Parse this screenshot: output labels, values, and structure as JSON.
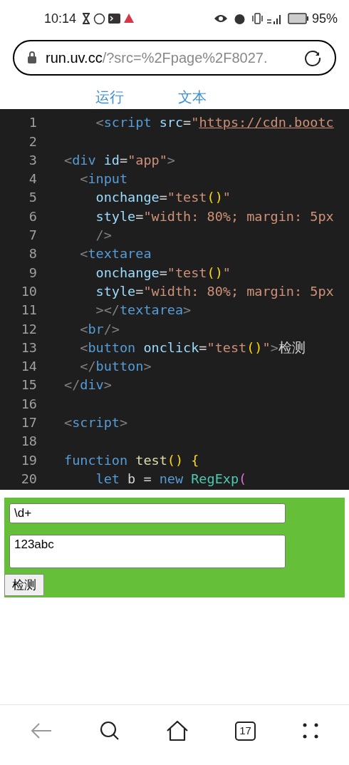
{
  "status_bar": {
    "time": "10:14",
    "battery": "95%"
  },
  "address_bar": {
    "host": "run.uv.cc",
    "path": "/?src=%2Fpage%2F8027."
  },
  "tabs": [
    {
      "label": "运行"
    },
    {
      "label": "文本"
    }
  ],
  "editor": {
    "lines": [
      {
        "number": "1",
        "tokens": [
          {
            "kind": "punct",
            "text": "    <"
          },
          {
            "kind": "tag",
            "text": "script"
          },
          {
            "kind": "attr",
            "text": " src"
          },
          {
            "kind": "plain",
            "text": "="
          },
          {
            "kind": "str",
            "text": "\""
          },
          {
            "kind": "url",
            "text": "https://cdn.bootc"
          }
        ]
      },
      {
        "number": "2"
      },
      {
        "number": "3",
        "tokens": [
          {
            "kind": "punct",
            "text": "<"
          },
          {
            "kind": "tag",
            "text": "div"
          },
          {
            "kind": "attr",
            "text": " id"
          },
          {
            "kind": "plain",
            "text": "="
          },
          {
            "kind": "str",
            "text": "\"app\""
          },
          {
            "kind": "punct",
            "text": ">"
          }
        ]
      },
      {
        "number": "4",
        "tokens": [
          {
            "kind": "punct",
            "text": "  <"
          },
          {
            "kind": "tag",
            "text": "input"
          }
        ]
      },
      {
        "number": "5",
        "tokens": [
          {
            "kind": "attr",
            "text": "    onchange"
          },
          {
            "kind": "plain",
            "text": "="
          },
          {
            "kind": "str",
            "text": "\"test"
          },
          {
            "kind": "paren",
            "text": "()"
          },
          {
            "kind": "str",
            "text": "\""
          }
        ]
      },
      {
        "number": "6",
        "tokens": [
          {
            "kind": "attr",
            "text": "    style"
          },
          {
            "kind": "plain",
            "text": "="
          },
          {
            "kind": "str",
            "text": "\"width: 80%; margin: 5px"
          }
        ]
      },
      {
        "number": "7",
        "tokens": [
          {
            "kind": "punct",
            "text": "    />"
          }
        ]
      },
      {
        "number": "8",
        "tokens": [
          {
            "kind": "punct",
            "text": "  <"
          },
          {
            "kind": "tag",
            "text": "textarea"
          }
        ]
      },
      {
        "number": "9",
        "tokens": [
          {
            "kind": "attr",
            "text": "    onchange"
          },
          {
            "kind": "plain",
            "text": "="
          },
          {
            "kind": "str",
            "text": "\"test"
          },
          {
            "kind": "paren",
            "text": "()"
          },
          {
            "kind": "str",
            "text": "\""
          }
        ]
      },
      {
        "number": "10",
        "tokens": [
          {
            "kind": "attr",
            "text": "    style"
          },
          {
            "kind": "plain",
            "text": "="
          },
          {
            "kind": "str",
            "text": "\"width: 80%; margin: 5px"
          }
        ]
      },
      {
        "number": "11",
        "tokens": [
          {
            "kind": "punct",
            "text": "    ></"
          },
          {
            "kind": "tag",
            "text": "textarea"
          },
          {
            "kind": "punct",
            "text": ">"
          }
        ]
      },
      {
        "number": "12",
        "tokens": [
          {
            "kind": "punct",
            "text": "  <"
          },
          {
            "kind": "tag",
            "text": "br"
          },
          {
            "kind": "punct",
            "text": "/>"
          }
        ]
      },
      {
        "number": "13",
        "tokens": [
          {
            "kind": "punct",
            "text": "  <"
          },
          {
            "kind": "tag",
            "text": "button"
          },
          {
            "kind": "attr",
            "text": " onclick"
          },
          {
            "kind": "plain",
            "text": "="
          },
          {
            "kind": "str",
            "text": "\"test"
          },
          {
            "kind": "paren",
            "text": "()"
          },
          {
            "kind": "str",
            "text": "\""
          },
          {
            "kind": "punct",
            "text": ">"
          },
          {
            "kind": "plain",
            "text": "检测"
          }
        ]
      },
      {
        "number": "14",
        "tokens": [
          {
            "kind": "punct",
            "text": "  </"
          },
          {
            "kind": "tag",
            "text": "button"
          },
          {
            "kind": "punct",
            "text": ">"
          }
        ]
      },
      {
        "number": "15",
        "tokens": [
          {
            "kind": "punct",
            "text": "</"
          },
          {
            "kind": "tag",
            "text": "div"
          },
          {
            "kind": "punct",
            "text": ">"
          }
        ]
      },
      {
        "number": "16"
      },
      {
        "number": "17",
        "tokens": [
          {
            "kind": "punct",
            "text": "<"
          },
          {
            "kind": "tag",
            "text": "script"
          },
          {
            "kind": "punct",
            "text": ">"
          }
        ]
      },
      {
        "number": "18"
      },
      {
        "number": "19",
        "tokens": [
          {
            "kind": "kw",
            "text": "function"
          },
          {
            "kind": "fn",
            "text": " test"
          },
          {
            "kind": "paren",
            "text": "() {"
          }
        ]
      },
      {
        "number": "20",
        "tokens": [
          {
            "kind": "kw",
            "text": "    let"
          },
          {
            "kind": "plain",
            "text": " b = "
          },
          {
            "kind": "kw",
            "text": "new"
          },
          {
            "kind": "cls",
            "text": " RegExp"
          },
          {
            "kind": "pink",
            "text": "("
          }
        ]
      }
    ]
  },
  "preview": {
    "input_value": "\\d+",
    "textarea_value": "123abc",
    "button": "检测"
  },
  "bottom_nav": {
    "tab_count": "17"
  }
}
